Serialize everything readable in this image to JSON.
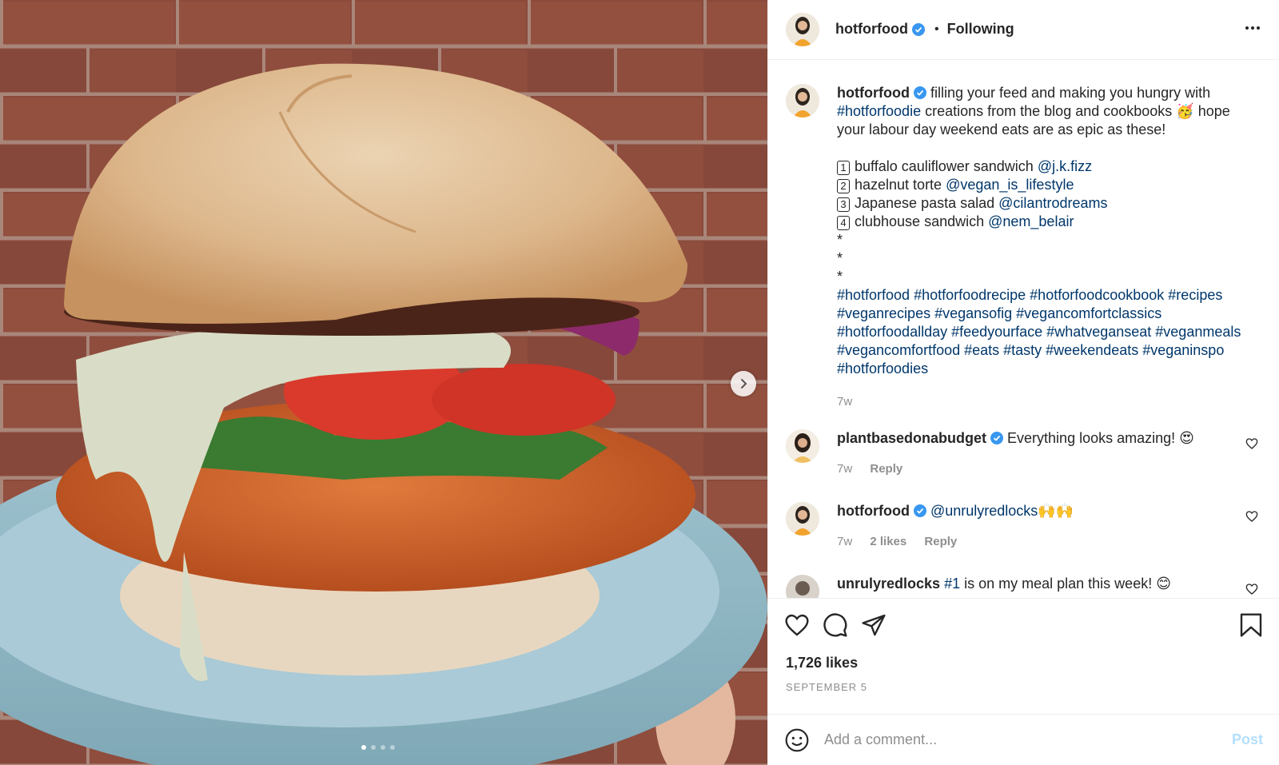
{
  "header": {
    "username": "hotforfood",
    "separator": "•",
    "follow_status": "Following"
  },
  "caption": {
    "username": "hotforfood",
    "text_1": "filling your feed and making you hungry with",
    "hashtag_1": "#hotforfoodie",
    "text_2": "creations from the blog and cookbooks 🥳 hope your labour day weekend eats are as epic as these!",
    "list": [
      {
        "num": "1",
        "text": "buffalo cauliflower sandwich",
        "mention": "@j.k.fizz"
      },
      {
        "num": "2",
        "text": "hazelnut torte",
        "mention": "@vegan_is_lifestyle"
      },
      {
        "num": "3",
        "text": "Japanese pasta salad",
        "mention": "@cilantrodreams"
      },
      {
        "num": "4",
        "text": "clubhouse sandwich",
        "mention": "@nem_belair"
      }
    ],
    "stars": [
      "*",
      "*",
      "*"
    ],
    "hashtags": "#hotforfood #hotforfoodrecipe #hotforfoodcookbook #recipes #veganrecipes #vegansofig #vegancomfortclassics #hotforfoodallday #feedyourface #whatveganseat #veganmeals #vegancomfortfood #eats #tasty #weekendeats #veganinspo #hotforfoodies",
    "time": "7w"
  },
  "comments": [
    {
      "username": "plantbasedonabudget",
      "text": "Everything looks amazing! 😍",
      "time": "7w",
      "likes": "",
      "reply": "Reply"
    },
    {
      "username": "hotforfood",
      "mention": "@unrulyredlocks",
      "text": "🙌🙌",
      "time": "7w",
      "likes": "2 likes",
      "reply": "Reply"
    },
    {
      "username": "unrulyredlocks",
      "mention": "#1",
      "text": "is on my meal plan this week! 😊"
    }
  ],
  "actions": {
    "likes": "1,726 likes",
    "date": "SEPTEMBER 5"
  },
  "comment_box": {
    "placeholder": "Add a comment...",
    "post_label": "Post"
  },
  "carousel": {
    "count": 4,
    "active": 0
  },
  "icons": [
    "verified-badge-icon",
    "more-icon",
    "next-arrow-icon",
    "heart-icon",
    "comment-icon",
    "share-icon",
    "bookmark-icon",
    "emoji-icon"
  ],
  "colors": {
    "link": "#00376b",
    "verified": "#3897f0",
    "muted": "#8e8e8e",
    "post_button": "#b2dffc"
  }
}
